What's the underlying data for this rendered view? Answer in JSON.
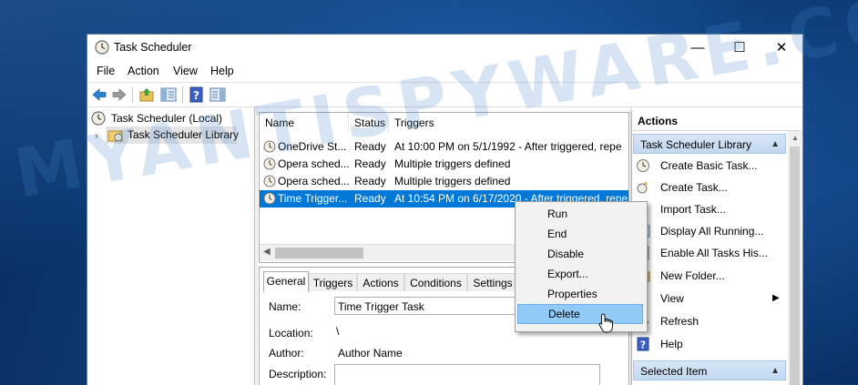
{
  "window": {
    "title": "Task Scheduler",
    "controls": {
      "minimize": "—",
      "maximize": "☐",
      "close": "✕"
    }
  },
  "menubar": [
    "File",
    "Action",
    "View",
    "Help"
  ],
  "toolbar": {
    "buttons": [
      "back-arrow-icon",
      "forward-arrow-icon",
      "up-folder-icon",
      "show-hide-tree-icon",
      "help-icon",
      "show-hide-action-pane-icon"
    ]
  },
  "tree": {
    "root": "Task Scheduler (Local)",
    "library": "Task Scheduler Library"
  },
  "task_list": {
    "columns": [
      "Name",
      "Status",
      "Triggers"
    ],
    "rows": [
      {
        "name": "OneDrive St...",
        "status": "Ready",
        "triggers": "At 10:00 PM on 5/1/1992 - After triggered, repe"
      },
      {
        "name": "Opera sched...",
        "status": "Ready",
        "triggers": "Multiple triggers defined"
      },
      {
        "name": "Opera sched...",
        "status": "Ready",
        "triggers": "Multiple triggers defined"
      },
      {
        "name": "Time Trigger...",
        "status": "Ready",
        "triggers": "At 10:54 PM on 6/17/2020 - After triggered, repe"
      }
    ]
  },
  "details": {
    "tabs": [
      "General",
      "Triggers",
      "Actions",
      "Conditions",
      "Settings"
    ],
    "name_label": "Name:",
    "name_value": "Time Trigger Task",
    "location_label": "Location:",
    "location_value": "\\",
    "author_label": "Author:",
    "author_value": "Author Name",
    "description_label": "Description:"
  },
  "actions": {
    "title": "Actions",
    "section1": "Task Scheduler Library",
    "items": [
      {
        "label": "Create Basic Task...",
        "icon": "create-basic-task-icon"
      },
      {
        "label": "Create Task...",
        "icon": "create-task-icon"
      },
      {
        "label": "Import Task...",
        "icon": ""
      },
      {
        "label": "Display All Running...",
        "icon": "display-running-icon"
      },
      {
        "label": "Enable All Tasks His...",
        "icon": "enable-history-icon"
      },
      {
        "label": "New Folder...",
        "icon": "new-folder-icon"
      },
      {
        "label": "View",
        "icon": ""
      },
      {
        "label": "Refresh",
        "icon": "refresh-icon"
      },
      {
        "label": "Help",
        "icon": "help-icon"
      }
    ],
    "section2": "Selected Item"
  },
  "context_menu": {
    "items": [
      "Run",
      "End",
      "Disable",
      "Export...",
      "Properties",
      "Delete"
    ],
    "highlighted": "Delete"
  },
  "watermark": "MYANTISPYWARE.COM",
  "colors": {
    "selection": "#0078d7",
    "menu_highlight": "#91c9f7",
    "section_header": "#c2d8f1"
  }
}
